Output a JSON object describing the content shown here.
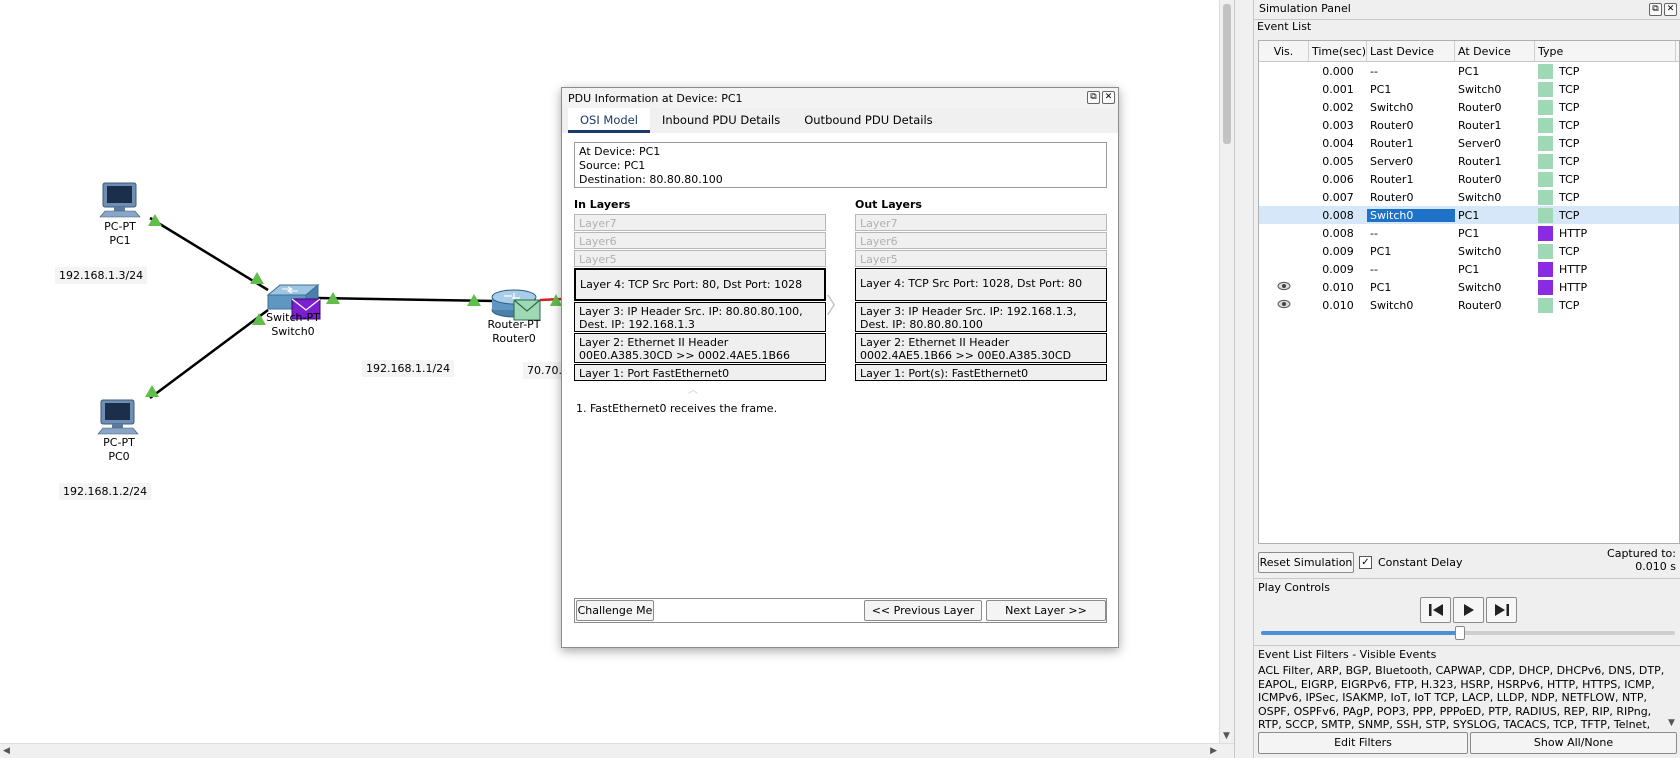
{
  "topology": {
    "devices": [
      {
        "id": "pc1",
        "type": "PC-PT",
        "name": "PC1"
      },
      {
        "id": "pc0",
        "type": "PC-PT",
        "name": "PC0"
      },
      {
        "id": "switch0",
        "type": "Switch-PT",
        "name": "Switch0"
      },
      {
        "id": "router0",
        "type": "Router-PT",
        "name": "Router0"
      }
    ],
    "ip_labels": [
      "192.168.1.3/24",
      "192.168.1.2/24",
      "192.168.1.1/24",
      "70.70."
    ]
  },
  "pdu_dialog": {
    "title": "PDU Information at Device: PC1",
    "tabs": [
      "OSI Model",
      "Inbound PDU Details",
      "Outbound PDU Details"
    ],
    "active_tab": 0,
    "info": {
      "at_device": "At Device: PC1",
      "source": "Source: PC1",
      "destination": "Destination: 80.80.80.100"
    },
    "in_layers_title": "In Layers",
    "out_layers_title": "Out Layers",
    "in_layers": [
      "Layer7",
      "Layer6",
      "Layer5",
      "Layer 4: TCP Src Port: 80, Dst Port: 1028",
      "Layer 3: IP Header Src. IP: 80.80.80.100, Dest. IP: 192.168.1.3",
      "Layer 2: Ethernet II Header 00E0.A385.30CD >> 0002.4AE5.1B66",
      "Layer 1: Port FastEthernet0"
    ],
    "out_layers": [
      "Layer7",
      "Layer6",
      "Layer5",
      "Layer 4: TCP Src Port: 1028, Dst Port: 80",
      "Layer 3: IP Header Src. IP: 192.168.1.3, Dest. IP: 80.80.80.100",
      "Layer 2: Ethernet II Header 0002.4AE5.1B66 >> 00E0.A385.30CD",
      "Layer 1: Port(s): FastEthernet0"
    ],
    "step_text": "1. FastEthernet0 receives the frame.",
    "buttons": {
      "challenge": "Challenge Me",
      "previous": "<< Previous Layer",
      "next": "Next Layer >>"
    }
  },
  "sim_panel": {
    "title": "Simulation Panel",
    "event_list_title": "Event List",
    "columns": [
      "Vis.",
      "Time(sec)",
      "Last Device",
      "At Device",
      "Type"
    ],
    "events": [
      {
        "vis": "",
        "time": "0.000",
        "last": "--",
        "at": "PC1",
        "type": "TCP",
        "color": "#9fd8b4"
      },
      {
        "vis": "",
        "time": "0.001",
        "last": "PC1",
        "at": "Switch0",
        "type": "TCP",
        "color": "#9fd8b4"
      },
      {
        "vis": "",
        "time": "0.002",
        "last": "Switch0",
        "at": "Router0",
        "type": "TCP",
        "color": "#9fd8b4"
      },
      {
        "vis": "",
        "time": "0.003",
        "last": "Router0",
        "at": "Router1",
        "type": "TCP",
        "color": "#9fd8b4"
      },
      {
        "vis": "",
        "time": "0.004",
        "last": "Router1",
        "at": "Server0",
        "type": "TCP",
        "color": "#9fd8b4"
      },
      {
        "vis": "",
        "time": "0.005",
        "last": "Server0",
        "at": "Router1",
        "type": "TCP",
        "color": "#9fd8b4"
      },
      {
        "vis": "",
        "time": "0.006",
        "last": "Router1",
        "at": "Router0",
        "type": "TCP",
        "color": "#9fd8b4"
      },
      {
        "vis": "",
        "time": "0.007",
        "last": "Router0",
        "at": "Switch0",
        "type": "TCP",
        "color": "#9fd8b4"
      },
      {
        "vis": "",
        "time": "0.008",
        "last": "Switch0",
        "at": "PC1",
        "type": "TCP",
        "color": "#9fd8b4",
        "selected": true
      },
      {
        "vis": "",
        "time": "0.008",
        "last": "--",
        "at": "PC1",
        "type": "HTTP",
        "color": "#8a2be2"
      },
      {
        "vis": "",
        "time": "0.009",
        "last": "PC1",
        "at": "Switch0",
        "type": "TCP",
        "color": "#9fd8b4"
      },
      {
        "vis": "",
        "time": "0.009",
        "last": "--",
        "at": "PC1",
        "type": "HTTP",
        "color": "#8a2be2"
      },
      {
        "vis": "eye",
        "time": "0.010",
        "last": "PC1",
        "at": "Switch0",
        "type": "HTTP",
        "color": "#8a2be2"
      },
      {
        "vis": "eye",
        "time": "0.010",
        "last": "Switch0",
        "at": "Router0",
        "type": "TCP",
        "color": "#9fd8b4"
      }
    ],
    "reset_button": "Reset Simulation",
    "constant_delay_label": "Constant Delay",
    "constant_delay_checked": "✓",
    "captured_label": "Captured to:",
    "captured_value": "0.010 s",
    "play_controls_title": "Play Controls",
    "slider_fraction": 0.48,
    "filters_title": "Event List Filters - Visible Events",
    "filters_text": "ACL Filter, ARP, BGP, Bluetooth, CAPWAP, CDP, DHCP, DHCPv6, DNS, DTP, EAPOL, EIGRP, EIGRPv6, FTP, H.323, HSRP, HSRPv6, HTTP, HTTPS, ICMP, ICMPv6, IPSec, ISAKMP, IoT, IoT TCP, LACP, LLDP, NDP, NETFLOW, NTP, OSPF, OSPFv6, PAgP, POP3, PPP, PPPoED, PTP, RADIUS, REP, RIP, RIPng, RTP, SCCP, SMTP, SNMP, SSH, STP, SYSLOG, TACACS, TCP, TFTP, Telnet, UDP, USB, VTP",
    "edit_filters": "Edit Filters",
    "show_all": "Show All/None",
    "colors": {
      "tcp": "#9fd8b4",
      "http": "#8a2be2",
      "selection": "#1e73c8",
      "row_highlight": "#d5e7f9"
    }
  }
}
